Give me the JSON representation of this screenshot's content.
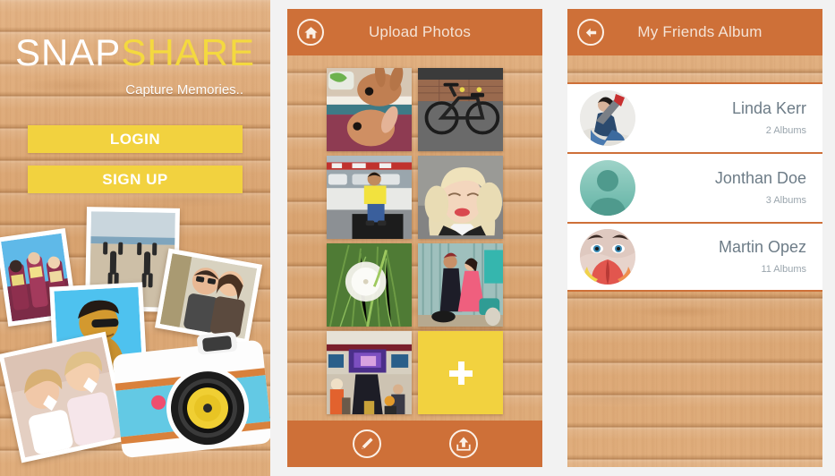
{
  "background_color": "#f2f2f2",
  "theme": {
    "orange": "#ce7038",
    "yellow": "#f2d23f",
    "wood": "#ddaa77",
    "white": "#ffffff",
    "text_gray": "#6d7c87"
  },
  "screens": [
    {
      "id": "splash",
      "logo": {
        "part_a": "SNAP",
        "part_b": "SHARE"
      },
      "tagline": "Capture Memories..",
      "buttons": [
        {
          "label": "LOGIN"
        },
        {
          "label": "SIGN UP"
        }
      ],
      "collage": {
        "icons": [
          "polaroid-photo",
          "polaroid-photo",
          "polaroid-photo",
          "polaroid-photo",
          "polaroid-photo",
          "retro-camera"
        ]
      }
    },
    {
      "id": "upload-photos",
      "header": {
        "title": "Upload Photos",
        "left_icon": "home-icon"
      },
      "photos": [
        {
          "alt": "rabbits"
        },
        {
          "alt": "bicycle"
        },
        {
          "alt": "man-in-yellow-shirt"
        },
        {
          "alt": "blonde-woman-portrait"
        },
        {
          "alt": "dandelion"
        },
        {
          "alt": "couple-traditional-dress"
        },
        {
          "alt": "event-hall"
        }
      ],
      "add_button": {
        "icon": "plus-icon",
        "label": "+"
      },
      "toolbar": [
        {
          "icon": "pencil-icon"
        },
        {
          "icon": "upload-icon"
        }
      ]
    },
    {
      "id": "my-friends-album",
      "header": {
        "title": "My Friends Album",
        "left_icon": "back-arrow-icon"
      },
      "friends": [
        {
          "name": "Linda Kerr",
          "albums": "2 Albums",
          "avatar": "photo-avatar-guitar-girl"
        },
        {
          "name": "Jonthan Doe",
          "albums": "3 Albums",
          "avatar": "placeholder-person-icon"
        },
        {
          "name": "Martin Opez",
          "albums": "11 Albums",
          "avatar": "photo-avatar-face-art"
        }
      ]
    }
  ]
}
